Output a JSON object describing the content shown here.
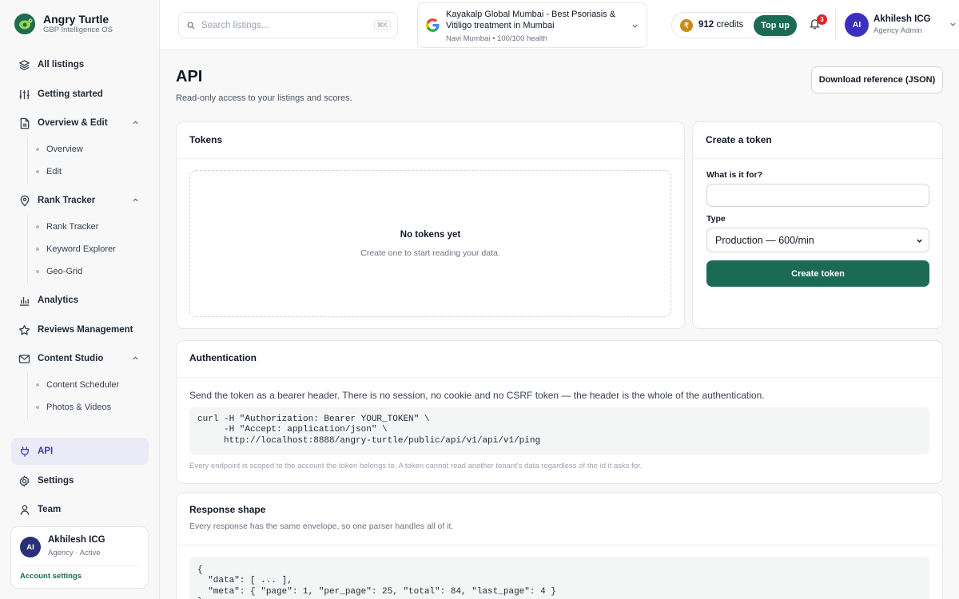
{
  "brand": {
    "name": "Angry Turtle",
    "tagline": "GBP Intelligence OS"
  },
  "sidebar": {
    "items": [
      {
        "label": "All listings",
        "icon": "layers-icon"
      },
      {
        "label": "Getting started",
        "icon": "sliders-icon"
      },
      {
        "label": "Overview & Edit",
        "icon": "document-icon",
        "expanded": true,
        "children": [
          "Overview",
          "Edit"
        ]
      },
      {
        "label": "Rank Tracker",
        "icon": "location-pin-icon",
        "expanded": true,
        "children": [
          "Rank Tracker",
          "Keyword Explorer",
          "Geo-Grid"
        ]
      },
      {
        "label": "Analytics",
        "icon": "bar-chart-icon"
      },
      {
        "label": "Reviews Management",
        "icon": "star-icon"
      },
      {
        "label": "Content Studio",
        "icon": "mail-icon",
        "expanded": true,
        "children": [
          "Content Scheduler",
          "Photos & Videos"
        ]
      },
      {
        "label": "API",
        "icon": "plug-icon",
        "active": true
      },
      {
        "label": "Settings",
        "icon": "gear-icon"
      },
      {
        "label": "Team",
        "icon": "person-icon"
      }
    ]
  },
  "sidebar_user": {
    "initials": "AI",
    "name": "Akhilesh ICG",
    "status": "Agency · Active",
    "link": "Account settings"
  },
  "topbar": {
    "search_placeholder": "Search listings...",
    "search_shortcut": "⌘K",
    "business": {
      "name": "Kayakalp Global Mumbai - Best Psoriasis & Vitiligo treatment in Mumbai",
      "meta": "Navi Mumbai • 100/100 health"
    },
    "credits": {
      "value": "912",
      "unit": "credits",
      "coin_symbol": "₹",
      "topup_label": "Top up"
    },
    "notifications": "3",
    "user": {
      "initials": "AI",
      "name": "Akhilesh ICG",
      "role": "Agency Admin"
    }
  },
  "page": {
    "title": "API",
    "subtitle": "Read-only access to your listings and scores.",
    "download_label": "Download reference (JSON)"
  },
  "tokens": {
    "title": "Tokens",
    "empty_title": "No tokens yet",
    "empty_text": "Create one to start reading your data."
  },
  "create_token": {
    "title": "Create a token",
    "purpose_label": "What is it for?",
    "purpose_value": "",
    "type_label": "Type",
    "type_selected": "Production — 600/min",
    "submit_label": "Create token"
  },
  "authentication": {
    "title": "Authentication",
    "description": "Send the token as a bearer header. There is no session, no cookie and no CSRF token — the header is the whole of the authentication.",
    "code": [
      "curl -H \"Authorization: Bearer YOUR_TOKEN\" \\",
      "     -H \"Accept: application/json\" \\",
      "     http://localhost:8888/angry-turtle/public/api/v1/api/v1/ping"
    ],
    "note": "Every endpoint is scoped to the account the token belongs to. A token cannot read another tenant's data regardless of the id it asks for."
  },
  "response_shape": {
    "title": "Response shape",
    "subtitle": "Every response has the same envelope, so one parser handles all of it.",
    "code": [
      "{",
      "  \"data\": [ ... ],",
      "  \"meta\": { \"page\": 1, \"per_page\": 25, \"total\": 84, \"last_page\": 4 }",
      "}"
    ]
  },
  "colors": {
    "accent": "#1b6b52",
    "active_nav_bg": "#ebebf8",
    "active_nav_text": "#3f3aa8",
    "badge": "#dc2626",
    "coin": "#c98a1a"
  }
}
